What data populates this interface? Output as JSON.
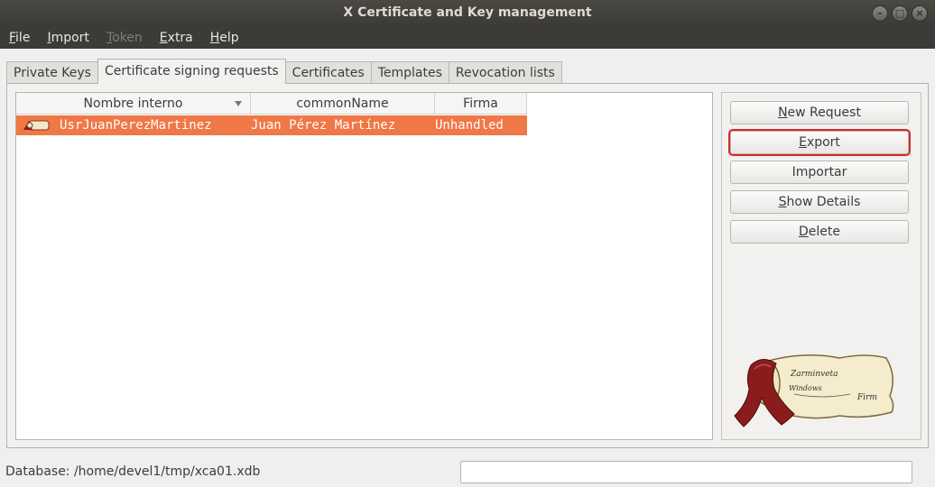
{
  "window": {
    "title": "X Certificate and Key management"
  },
  "menu": [
    {
      "label": "File",
      "first": "F",
      "rest": "ile",
      "enabled": true
    },
    {
      "label": "Import",
      "first": "I",
      "rest": "mport",
      "enabled": true
    },
    {
      "label": "Token",
      "first": "T",
      "rest": "oken",
      "enabled": false
    },
    {
      "label": "Extra",
      "first": "E",
      "rest": "xtra",
      "enabled": true
    },
    {
      "label": "Help",
      "first": "H",
      "rest": "elp",
      "enabled": true
    }
  ],
  "tabs": [
    {
      "label": "Private Keys"
    },
    {
      "label": "Certificate signing requests",
      "active": true
    },
    {
      "label": "Certificates"
    },
    {
      "label": "Templates"
    },
    {
      "label": "Revocation lists"
    }
  ],
  "table": {
    "columns": [
      "Nombre interno",
      "commonName",
      "Firma"
    ],
    "rows": [
      {
        "name": "UsrJuanPerezMartinez",
        "commonName": "Juan Pérez Martínez",
        "signature": "Unhandled",
        "selected": true
      }
    ]
  },
  "buttons": {
    "new_request": {
      "pre": "",
      "ul": "N",
      "post": "ew Request"
    },
    "export": {
      "pre": "",
      "ul": "E",
      "post": "xport"
    },
    "import": {
      "pre": "",
      "ul": "",
      "post": "Importar"
    },
    "show_details": {
      "pre": "",
      "ul": "S",
      "post": "how Details"
    },
    "delete": {
      "pre": "",
      "ul": "D",
      "post": "elete"
    }
  },
  "scroll_logo": {
    "line1": "Zarminveta",
    "line2": "Windows",
    "line3": "Firm"
  },
  "status": {
    "database": "Database: /home/devel1/tmp/xca01.xdb",
    "input_value": ""
  },
  "colors": {
    "selection": "#f07746",
    "focus_outline": "#d42a2a",
    "titlebar": "#3c3b37"
  }
}
